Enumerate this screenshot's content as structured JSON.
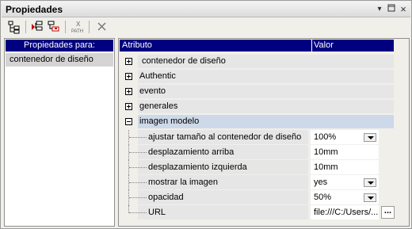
{
  "window": {
    "title": "Propiedades"
  },
  "titlebar": {
    "dropdown_icon": "▾",
    "pin_icon": "⊞",
    "close_icon": "×"
  },
  "left": {
    "header": "Propiedades para:",
    "items": [
      {
        "label": "contenedor de diseño"
      }
    ]
  },
  "table": {
    "header": {
      "attribute": "Atributo",
      "value": "Valor"
    },
    "groups": [
      {
        "label": "contenedor de diseño"
      },
      {
        "label": "Authentic"
      },
      {
        "label": "evento"
      },
      {
        "label": "generales"
      },
      {
        "label": "imagen modelo"
      }
    ],
    "rows": [
      {
        "name": "ajustar tamaño al contenedor de diseño",
        "value": "100%",
        "control": "dropdown"
      },
      {
        "name": "desplazamiento arriba",
        "value": "10mm",
        "control": "none"
      },
      {
        "name": "desplazamiento izquierda",
        "value": "10mm",
        "control": "none"
      },
      {
        "name": "mostrar la imagen",
        "value": "yes",
        "control": "dropdown"
      },
      {
        "name": "opacidad",
        "value": "50%",
        "control": "dropdown"
      },
      {
        "name": "URL",
        "value": "file:///C:/Users/...",
        "control": "ellipsis",
        "ellipsis_label": "..."
      }
    ]
  },
  "toolbar": {
    "path_label": "PATH"
  }
}
